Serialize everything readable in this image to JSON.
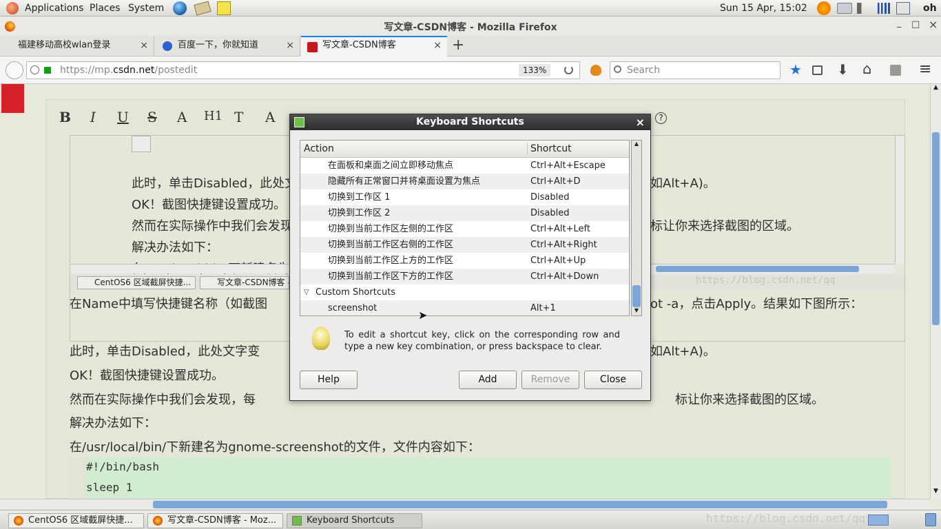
{
  "panel": {
    "applications": "Applications",
    "places": "Places",
    "system": "System",
    "clock": "Sun 15 Apr, 15:02",
    "user": "oh"
  },
  "window": {
    "title": "写文章-CSDN博客 - Mozilla Firefox",
    "minimize": "_",
    "maximize": "□",
    "close": "×"
  },
  "tabs": [
    {
      "label": "福建移动高校wlan登录"
    },
    {
      "label": "百度一下，你就知道"
    },
    {
      "label": "写文章-CSDN博客"
    }
  ],
  "tab_close": "×",
  "new_tab": "+",
  "nav": {
    "url_prefix": "https://mp.",
    "url_domain": "csdn.net",
    "url_path": "/postedit",
    "zoom": "133%",
    "search_placeholder": "Search"
  },
  "editor": {
    "toolbar": [
      "B",
      "I",
      "U",
      "S",
      "A",
      "H1",
      "T",
      "A"
    ],
    "help_glyph": "?",
    "inner_lines": [
      "此时，单击Disabled，此处文",
      "OK！截图快捷键设置成功。",
      "然而在实际操作中我们会发现",
      "解决办法如下：",
      "在/usr/local/bin/下新建名为"
    ],
    "inner_right": [
      "如Alt+A)。",
      "标让你来选择截图的区域。"
    ],
    "inner_tasks": [
      "CentOS6 区域截屏快捷...",
      "写文章-CSDN博客 -"
    ],
    "watermark": "https://blog.csdn.net/qq",
    "lines": [
      {
        "left": "在Name中填写快捷键名称（如截图",
        "right": "ot -a，点击Apply。结果如下图所示："
      },
      {
        "left": "此时，单击Disabled，此处文字变",
        "right": "如Alt+A)。"
      },
      {
        "left": "OK！截图快捷键设置成功。",
        "right": ""
      },
      {
        "left": "然而在实际操作中我们会发现，每",
        "right": "标让你来选择截图的区域。"
      },
      {
        "left": "解决办法如下：",
        "right": ""
      },
      {
        "left": "在/usr/local/bin/下新建名为gnome-screenshot的文件，文件内容如下：",
        "right": ""
      }
    ],
    "code": [
      "#!/bin/bash",
      "sleep 1"
    ]
  },
  "dialog": {
    "title": "Keyboard Shortcuts",
    "close": "×",
    "col_action": "Action",
    "col_shortcut": "Shortcut",
    "rows": [
      {
        "action": "在面板和桌面之间立即移动焦点",
        "shortcut": "Ctrl+Alt+Escape"
      },
      {
        "action": "隐藏所有正常窗口并将桌面设置为焦点",
        "shortcut": "Ctrl+Alt+D"
      },
      {
        "action": "切换到工作区 1",
        "shortcut": "Disabled"
      },
      {
        "action": "切换到工作区 2",
        "shortcut": "Disabled"
      },
      {
        "action": "切换到当前工作区左侧的工作区",
        "shortcut": "Ctrl+Alt+Left"
      },
      {
        "action": "切换到当前工作区右侧的工作区",
        "shortcut": "Ctrl+Alt+Right"
      },
      {
        "action": "切换到当前工作区上方的工作区",
        "shortcut": "Ctrl+Alt+Up"
      },
      {
        "action": "切换到当前工作区下方的工作区",
        "shortcut": "Ctrl+Alt+Down"
      }
    ],
    "group": "Custom Shortcuts",
    "custom_rows": [
      {
        "action": "screenshot",
        "shortcut": "Alt+1"
      }
    ],
    "hint": "To edit a shortcut key, click on the corresponding row and type a new key combination, or press backspace to clear.",
    "help": "Help",
    "add": "Add",
    "remove": "Remove",
    "close_btn": "Close"
  },
  "taskbar": [
    {
      "label": "CentOS6 区域截屏快捷..."
    },
    {
      "label": "写文章-CSDN博客 - Moz..."
    },
    {
      "label": "Keyboard Shortcuts"
    }
  ],
  "taskbar_watermark": "https://blog.csdn.net/qq"
}
